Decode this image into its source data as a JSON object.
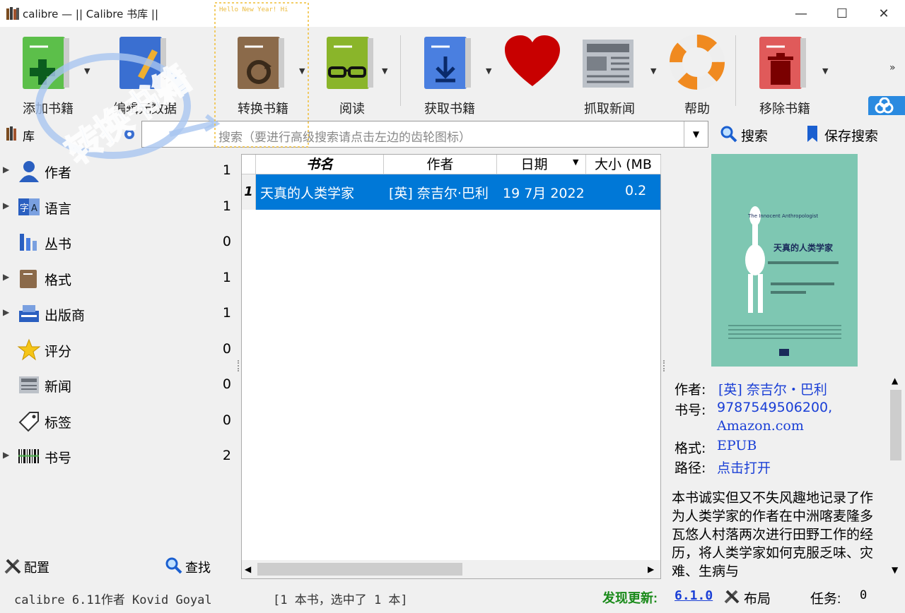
{
  "window": {
    "title": "calibre — || Calibre 书库 ||"
  },
  "toolbar": {
    "add_books": "添加书籍",
    "edit_metadata": "编辑元数据",
    "convert_books": "转换书籍",
    "view": "阅读",
    "get_books": "获取书籍",
    "donate": "",
    "fetch_news": "抓取新闻",
    "help": "帮助",
    "remove_books": "移除书籍"
  },
  "search": {
    "library_label": "库",
    "placeholder": "搜索（要进行高级搜索请点击左边的齿轮图标）",
    "search_button": "搜索",
    "saved_search_button": "保存搜索"
  },
  "tag_browser": {
    "items": [
      {
        "name": "作者",
        "count": "1",
        "icon": "person-icon",
        "expandable": true
      },
      {
        "name": "语言",
        "count": "1",
        "icon": "language-icon",
        "expandable": true
      },
      {
        "name": "丛书",
        "count": "0",
        "icon": "series-icon",
        "expandable": false
      },
      {
        "name": "格式",
        "count": "1",
        "icon": "format-icon",
        "expandable": true
      },
      {
        "name": "出版商",
        "count": "1",
        "icon": "publisher-icon",
        "expandable": true
      },
      {
        "name": "评分",
        "count": "0",
        "icon": "star-icon",
        "expandable": false
      },
      {
        "name": "新闻",
        "count": "0",
        "icon": "news-icon",
        "expandable": false
      },
      {
        "name": "标签",
        "count": "0",
        "icon": "tag-icon",
        "expandable": false
      },
      {
        "name": "书号",
        "count": "2",
        "icon": "barcode-icon",
        "expandable": true
      }
    ],
    "configure": "配置",
    "find": "查找"
  },
  "book_table": {
    "columns": [
      "书名",
      "作者",
      "日期",
      "大小 (MB"
    ],
    "rows": [
      {
        "num": "1",
        "title": "天真的人类学家",
        "author": "[英] 奈吉尔·巴利",
        "date": "19 7月 2022",
        "size": "0.2"
      }
    ]
  },
  "details": {
    "author_label": "作者:",
    "author_value": "[英] 奈吉尔・巴利",
    "isbn_label": "书号:",
    "isbn_value": "9787549506200,",
    "isbn_source": "Amazon.com",
    "format_label": "格式:",
    "format_value": "EPUB",
    "path_label": "路径:",
    "path_value": "点击打开",
    "description": "本书诚实但又不失风趣地记录了作为人类学家的作者在中洲喀麦隆多瓦悠人村落两次进行田野工作的经历，将人类学家如何克服乏味、灾难、生病与",
    "cover_title": "天真的人类学家",
    "cover_subtitle": "The Innocent Anthropologist"
  },
  "status_bar": {
    "version": "calibre 6.11作者 Kovid Goyal",
    "book_count": "[1 本书，选中了 1 本]",
    "update_label": "发现更新:",
    "update_version": "6.1.0",
    "layout": "布局",
    "jobs_label": "任务:",
    "jobs_count": "0"
  },
  "watermark": {
    "text": "转换书籍",
    "sticker": "Hello New Year! Hi"
  },
  "colors": {
    "selection": "#0078d7",
    "link": "#1a3fd6",
    "update": "#1a8a1a"
  }
}
